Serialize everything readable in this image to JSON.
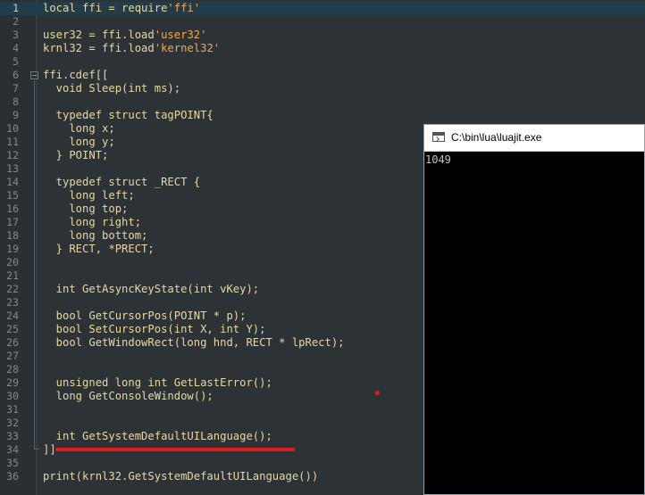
{
  "editor": {
    "lines": [
      {
        "n": "1",
        "code": "local ffi = require'ffi'"
      },
      {
        "n": "2",
        "code": ""
      },
      {
        "n": "3",
        "code": "user32 = ffi.load'user32'"
      },
      {
        "n": "4",
        "code": "krnl32 = ffi.load'kernel32'"
      },
      {
        "n": "5",
        "code": ""
      },
      {
        "n": "6",
        "code": "ffi.cdef[["
      },
      {
        "n": "7",
        "code": "  void Sleep(int ms);"
      },
      {
        "n": "8",
        "code": ""
      },
      {
        "n": "9",
        "code": "  typedef struct tagPOINT{"
      },
      {
        "n": "10",
        "code": "    long x;"
      },
      {
        "n": "11",
        "code": "    long y;"
      },
      {
        "n": "12",
        "code": "  } POINT;"
      },
      {
        "n": "13",
        "code": ""
      },
      {
        "n": "14",
        "code": "  typedef struct _RECT {"
      },
      {
        "n": "15",
        "code": "    long left;"
      },
      {
        "n": "16",
        "code": "    long top;"
      },
      {
        "n": "17",
        "code": "    long right;"
      },
      {
        "n": "18",
        "code": "    long bottom;"
      },
      {
        "n": "19",
        "code": "  } RECT, *PRECT;"
      },
      {
        "n": "20",
        "code": ""
      },
      {
        "n": "21",
        "code": ""
      },
      {
        "n": "22",
        "code": "  int GetAsyncKeyState(int vKey);"
      },
      {
        "n": "23",
        "code": ""
      },
      {
        "n": "24",
        "code": "  bool GetCursorPos(POINT * p);"
      },
      {
        "n": "25",
        "code": "  bool SetCursorPos(int X, int Y);"
      },
      {
        "n": "26",
        "code": "  bool GetWindowRect(long hnd, RECT * lpRect);"
      },
      {
        "n": "27",
        "code": ""
      },
      {
        "n": "28",
        "code": ""
      },
      {
        "n": "29",
        "code": "  unsigned long int GetLastError();"
      },
      {
        "n": "30",
        "code": "  long GetConsoleWindow();"
      },
      {
        "n": "31",
        "code": ""
      },
      {
        "n": "32",
        "code": ""
      },
      {
        "n": "33",
        "code": "  int GetSystemDefaultUILanguage();"
      },
      {
        "n": "34",
        "code": "]]"
      },
      {
        "n": "35",
        "code": ""
      },
      {
        "n": "36",
        "code": "print(krnl32.GetSystemDefaultUILanguage())"
      }
    ]
  },
  "console": {
    "title": "C:\\bin\\lua\\luajit.exe",
    "output": "1049"
  },
  "colors": {
    "annotation_red": "#e01b1b",
    "string_orange": "#f7a84a",
    "code_text": "#e8d8a0"
  }
}
